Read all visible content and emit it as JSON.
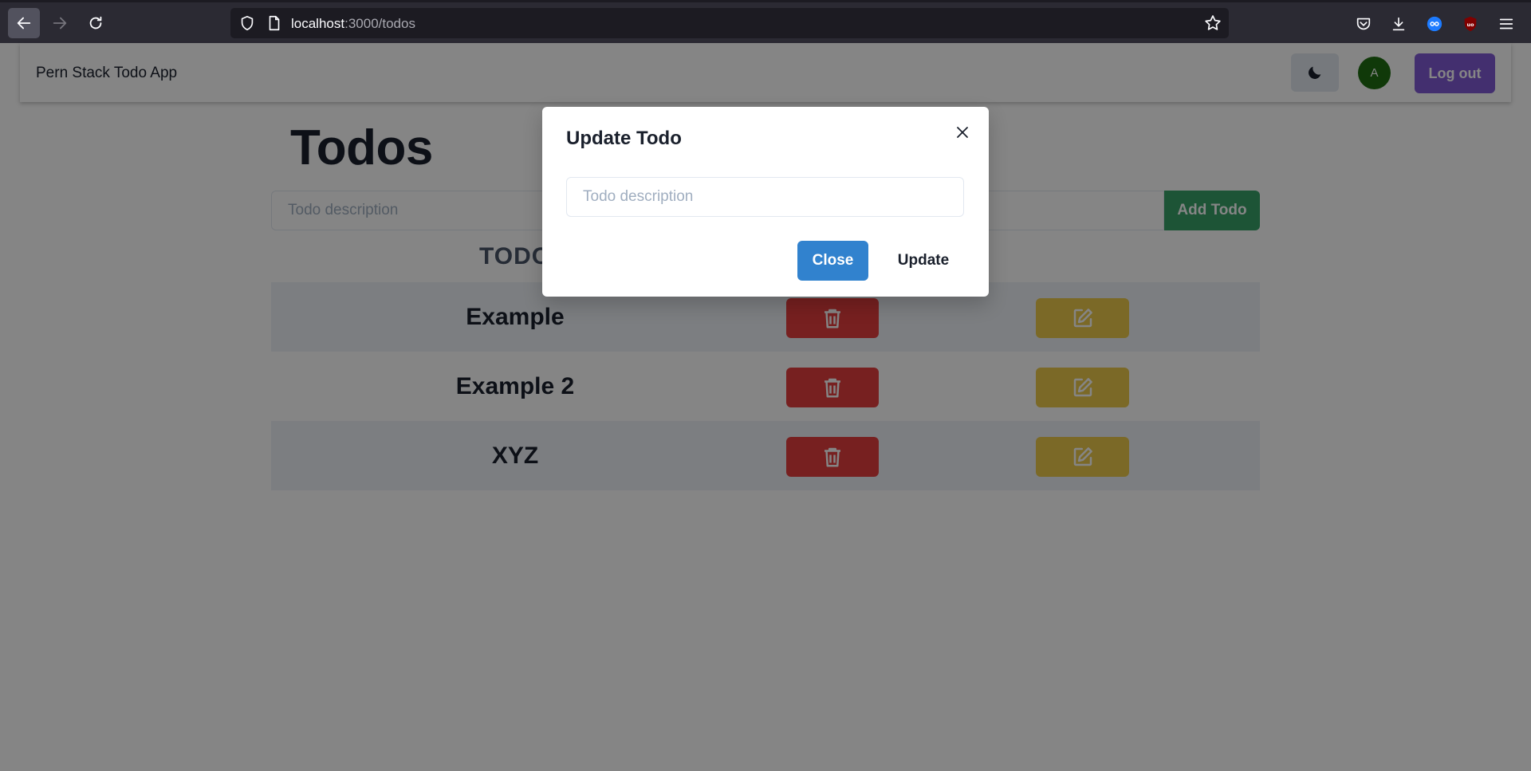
{
  "browser": {
    "url_host": "localhost",
    "url_path": ":3000/todos"
  },
  "navbar": {
    "brand": "Pern Stack Todo App",
    "avatar_initial": "A",
    "logout_label": "Log out"
  },
  "main": {
    "title": "Todos",
    "input_placeholder": "Todo description",
    "add_label": "Add Todo",
    "table_header": "TODO"
  },
  "todos": [
    {
      "description": "Example"
    },
    {
      "description": "Example 2"
    },
    {
      "description": "XYZ"
    }
  ],
  "modal": {
    "title": "Update Todo",
    "input_placeholder": "Todo description",
    "close_label": "Close",
    "update_label": "Update"
  },
  "colors": {
    "logout": "#805ad5",
    "add": "#38a169",
    "delete": "#e53e3e",
    "edit": "#ecc94b",
    "close_button": "#3182ce",
    "avatar": "#1f6e12"
  },
  "icons": [
    "back-arrow-icon",
    "forward-arrow-icon",
    "reload-icon",
    "shield-icon",
    "page-icon",
    "star-icon",
    "pocket-icon",
    "download-icon",
    "extension-icon",
    "ublock-icon",
    "menu-icon",
    "moon-icon",
    "trash-icon",
    "edit-icon",
    "close-icon"
  ]
}
